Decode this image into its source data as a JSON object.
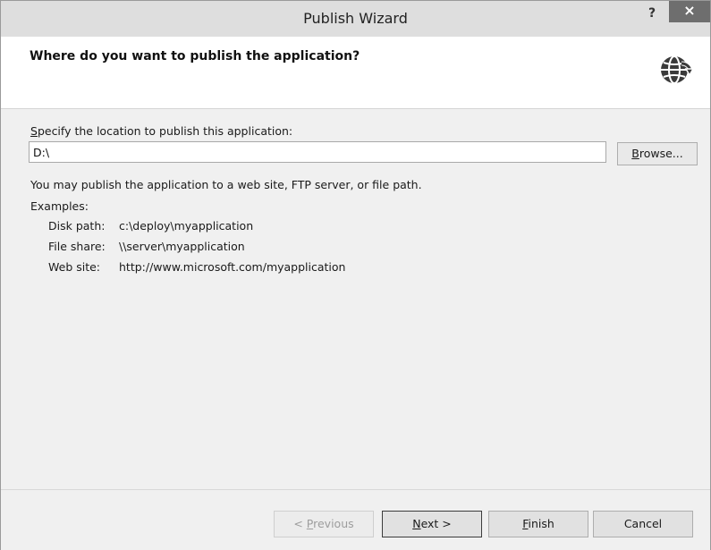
{
  "window": {
    "title": "Publish Wizard",
    "help_label": "?",
    "close_label": "×"
  },
  "header": {
    "title": "Where do you want to publish the application?",
    "icon": "globe-publish-icon"
  },
  "location": {
    "label_prefix": "S",
    "label_rest": "pecify the location to publish this application:",
    "value": "D:\\",
    "browse_prefix": "B",
    "browse_rest": "rowse..."
  },
  "hint": "You may publish the application to a web site, FTP server, or file path.",
  "examples": {
    "label": "Examples:",
    "items": [
      {
        "key": "Disk path:",
        "value": "c:\\deploy\\myapplication"
      },
      {
        "key": "File share:",
        "value": "\\\\server\\myapplication"
      },
      {
        "key": "Web site:",
        "value": "http://www.microsoft.com/myapplication"
      }
    ]
  },
  "buttons": {
    "previous_lead": "< ",
    "previous_accel": "P",
    "previous_rest": "revious",
    "next_accel": "N",
    "next_rest": "ext >",
    "finish_accel": "F",
    "finish_rest": "inish",
    "cancel": "Cancel"
  }
}
